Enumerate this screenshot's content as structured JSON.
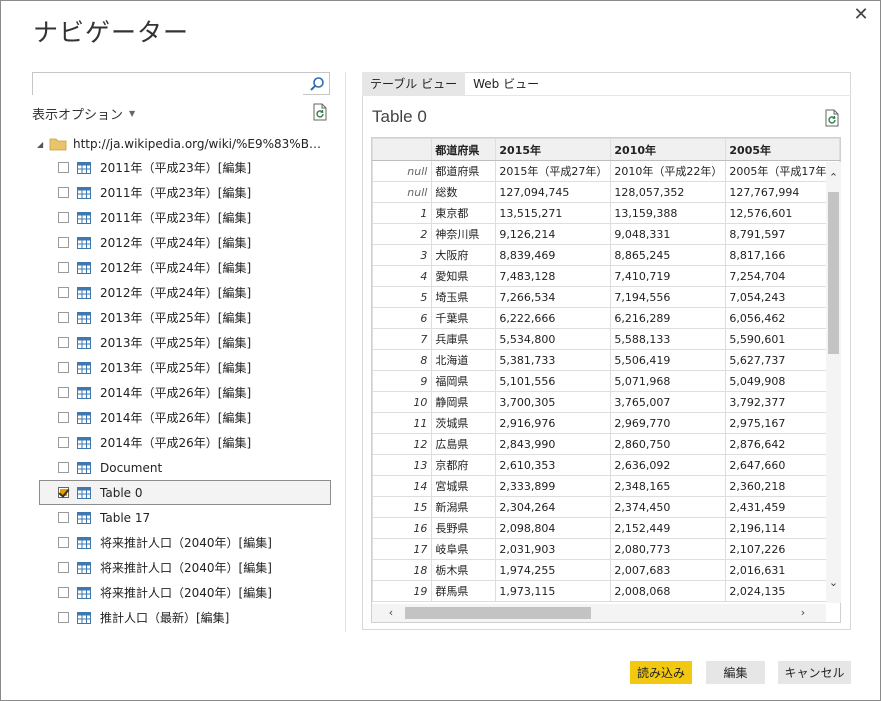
{
  "window": {
    "title": "ナビゲーター",
    "close": "✕"
  },
  "search": {
    "value": "",
    "placeholder": ""
  },
  "display_options": {
    "label": "表示オプション",
    "caret": "▼"
  },
  "tree": {
    "expander": "◢",
    "root_label": "http://ja.wikipedia.org/wiki/%E9%83%BD%E9...",
    "items": [
      {
        "label": "2011年（平成23年）[編集]",
        "checked": false
      },
      {
        "label": "2011年（平成23年）[編集]",
        "checked": false
      },
      {
        "label": "2011年（平成23年）[編集]",
        "checked": false
      },
      {
        "label": "2012年（平成24年）[編集]",
        "checked": false
      },
      {
        "label": "2012年（平成24年）[編集]",
        "checked": false
      },
      {
        "label": "2012年（平成24年）[編集]",
        "checked": false
      },
      {
        "label": "2013年（平成25年）[編集]",
        "checked": false
      },
      {
        "label": "2013年（平成25年）[編集]",
        "checked": false
      },
      {
        "label": "2013年（平成25年）[編集]",
        "checked": false
      },
      {
        "label": "2014年（平成26年）[編集]",
        "checked": false
      },
      {
        "label": "2014年（平成26年）[編集]",
        "checked": false
      },
      {
        "label": "2014年（平成26年）[編集]",
        "checked": false
      },
      {
        "label": "Document",
        "checked": false
      },
      {
        "label": "Table 0",
        "checked": true,
        "selected": true
      },
      {
        "label": "Table 17",
        "checked": false
      },
      {
        "label": "将来推計人口（2040年）[編集]",
        "checked": false
      },
      {
        "label": "将来推計人口（2040年）[編集]",
        "checked": false
      },
      {
        "label": "将来推計人口（2040年）[編集]",
        "checked": false
      },
      {
        "label": "推計人口（最新）[編集]",
        "checked": false
      }
    ]
  },
  "preview": {
    "tabs": [
      {
        "label": "テーブル ビュー",
        "active": true
      },
      {
        "label": "Web ビュー",
        "active": false
      }
    ],
    "title": "Table 0",
    "columns": [
      "",
      "都道府県",
      "2015年",
      "2010年",
      "2005年"
    ],
    "rows": [
      [
        "null",
        "都道府県",
        "2015年（平成27年）",
        "2010年（平成22年）",
        "2005年（平成17年"
      ],
      [
        "null",
        "総数",
        "127,094,745",
        "128,057,352",
        "127,767,994"
      ],
      [
        "1",
        "東京都",
        "13,515,271",
        "13,159,388",
        "12,576,601"
      ],
      [
        "2",
        "神奈川県",
        "9,126,214",
        "9,048,331",
        "8,791,597"
      ],
      [
        "3",
        "大阪府",
        "8,839,469",
        "8,865,245",
        "8,817,166"
      ],
      [
        "4",
        "愛知県",
        "7,483,128",
        "7,410,719",
        "7,254,704"
      ],
      [
        "5",
        "埼玉県",
        "7,266,534",
        "7,194,556",
        "7,054,243"
      ],
      [
        "6",
        "千葉県",
        "6,222,666",
        "6,216,289",
        "6,056,462"
      ],
      [
        "7",
        "兵庫県",
        "5,534,800",
        "5,588,133",
        "5,590,601"
      ],
      [
        "8",
        "北海道",
        "5,381,733",
        "5,506,419",
        "5,627,737"
      ],
      [
        "9",
        "福岡県",
        "5,101,556",
        "5,071,968",
        "5,049,908"
      ],
      [
        "10",
        "静岡県",
        "3,700,305",
        "3,765,007",
        "3,792,377"
      ],
      [
        "11",
        "茨城県",
        "2,916,976",
        "2,969,770",
        "2,975,167"
      ],
      [
        "12",
        "広島県",
        "2,843,990",
        "2,860,750",
        "2,876,642"
      ],
      [
        "13",
        "京都府",
        "2,610,353",
        "2,636,092",
        "2,647,660"
      ],
      [
        "14",
        "宮城県",
        "2,333,899",
        "2,348,165",
        "2,360,218"
      ],
      [
        "15",
        "新潟県",
        "2,304,264",
        "2,374,450",
        "2,431,459"
      ],
      [
        "16",
        "長野県",
        "2,098,804",
        "2,152,449",
        "2,196,114"
      ],
      [
        "17",
        "岐阜県",
        "2,031,903",
        "2,080,773",
        "2,107,226"
      ],
      [
        "18",
        "栃木県",
        "1,974,255",
        "2,007,683",
        "2,016,631"
      ],
      [
        "19",
        "群馬県",
        "1,973,115",
        "2,008,068",
        "2,024,135"
      ]
    ],
    "scroll": {
      "up": "⌃",
      "down": "⌄",
      "left": "‹",
      "right": "›"
    }
  },
  "buttons": {
    "load": "読み込み",
    "edit": "編集",
    "cancel": "キャンセル"
  },
  "colors": {
    "primary": "#f2c811",
    "accent_folder": "#e8c56a",
    "table_icon": "#3d78b0"
  }
}
